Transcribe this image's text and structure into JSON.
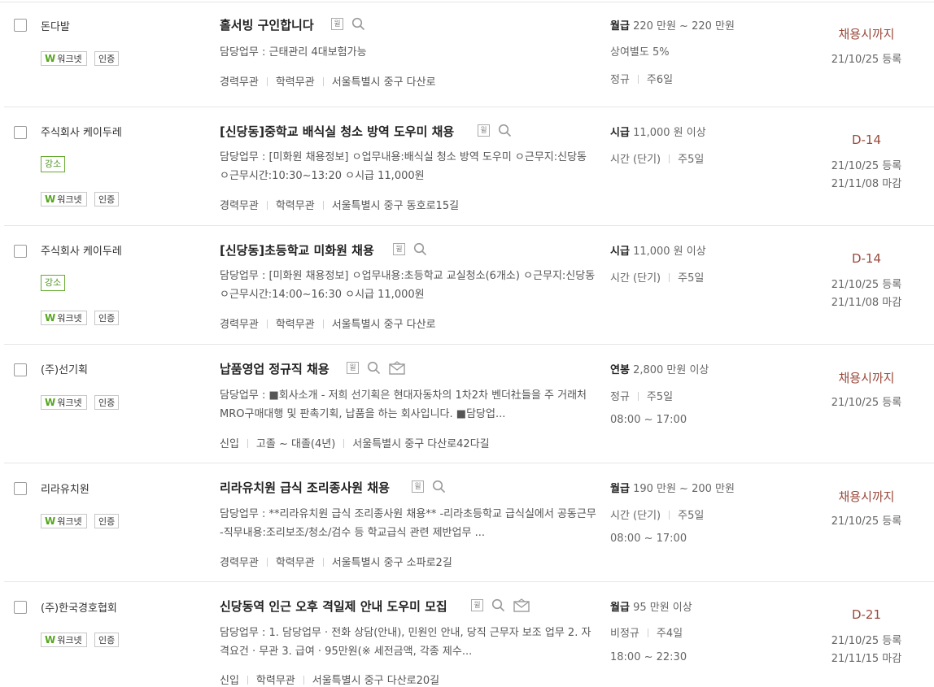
{
  "tags": {
    "worknet": "워크넷",
    "worknet_icon": "W",
    "certified": "인증",
    "gangso": "강소"
  },
  "icons": {
    "badge_glyph": "윌",
    "badge_name": "scrap-badge-icon",
    "search_name": "search-icon",
    "mail_name": "mail-icon"
  },
  "colors": {
    "deadline": "#9a4a3c",
    "worknet_green": "#55a51f",
    "gangso_green": "#4f9625"
  },
  "jobs": [
    {
      "company": "돈다발",
      "title": "홀서빙 구인합니다",
      "desc": "담당업무 : 근태관리 4대보험가능",
      "conditions": [
        "경력무관",
        "학력무관",
        "서울특별시 중구 다산로"
      ],
      "pay_type": "월급",
      "pay": "220 만원 ~ 220 만원",
      "extra": "상여별도 5%",
      "meta": [
        "정규",
        "주6일"
      ],
      "deadline": "채용시까지",
      "registered": "21/10/25 등록"
    },
    {
      "company": "주식회사 케이두레",
      "title": "[신당동]중학교 배식실 청소 방역 도우미 채용",
      "desc": "담당업무 : [미화원 채용정보] ㅇ업무내용:배식실 청소 방역 도우미 ㅇ근무지:신당동 ㅇ근무시간:10:30~13:20 ㅇ시급 11,000원",
      "conditions": [
        "경력무관",
        "학력무관",
        "서울특별시 중구 동호로15길"
      ],
      "pay_type": "시급",
      "pay": "11,000 원 이상",
      "meta": [
        "시간 (단기)",
        "주5일"
      ],
      "deadline": "D-14",
      "registered": "21/10/25 등록",
      "closing": "21/11/08 마감"
    },
    {
      "company": "주식회사 케이두레",
      "title": "[신당동]초등학교 미화원 채용",
      "desc": "담당업무 : [미화원 채용정보] ㅇ업무내용:초등학교 교실청소(6개소) ㅇ근무지:신당동 ㅇ근무시간:14:00~16:30 ㅇ시급 11,000원",
      "conditions": [
        "경력무관",
        "학력무관",
        "서울특별시 중구 다산로"
      ],
      "pay_type": "시급",
      "pay": "11,000 원 이상",
      "meta": [
        "시간 (단기)",
        "주5일"
      ],
      "deadline": "D-14",
      "registered": "21/10/25 등록",
      "closing": "21/11/08 마감"
    },
    {
      "company": "(주)선기획",
      "title": "납품영업 정규직 채용",
      "desc": "담당업무 : ■회사소개 - 저희 선기획은 현대자동차의 1차2차 벤더社들을 주 거래처 MRO구매대행 및 판촉기획, 납품을 하는 회사입니다. ■담당업...",
      "conditions": [
        "신입",
        "고졸 ~ 대졸(4년)",
        "서울특별시 중구 다산로42다길"
      ],
      "pay_type": "연봉",
      "pay": "2,800 만원 이상",
      "meta": [
        "정규",
        "주5일"
      ],
      "hours": "08:00 ~ 17:00",
      "deadline": "채용시까지",
      "registered": "21/10/25 등록"
    },
    {
      "company": "리라유치원",
      "title": "리라유치원 급식 조리종사원 채용",
      "desc": "담당업무 : **리라유치원 급식 조리종사원 채용** -리라초등학교 급식실에서 공동근무 -직무내용:조리보조/청소/검수 등 학교급식 관련 제반업무 ...",
      "conditions": [
        "경력무관",
        "학력무관",
        "서울특별시 중구 소파로2길"
      ],
      "pay_type": "월급",
      "pay": "190 만원 ~ 200 만원",
      "meta": [
        "시간 (단기)",
        "주5일"
      ],
      "hours": "08:00 ~ 17:00",
      "deadline": "채용시까지",
      "registered": "21/10/25 등록"
    },
    {
      "company": "(주)한국경호협회",
      "title": "신당동역 인근 오후 격일제 안내 도우미 모집",
      "desc": "담당업무 : 1. 담당업무 · 전화 상담(안내), 민원인 안내, 당직 근무자 보조 업무 2. 자격요건 · 무관 3. 급여 · 95만원(※ 세전금액, 각종 제수...",
      "conditions": [
        "신입",
        "학력무관",
        "서울특별시 중구 다산로20길"
      ],
      "pay_type": "월급",
      "pay": "95 만원 이상",
      "meta": [
        "비정규",
        "주4일"
      ],
      "hours": "18:00 ~ 22:30",
      "deadline": "D-21",
      "registered": "21/10/25 등록",
      "closing": "21/11/15 마감"
    }
  ]
}
